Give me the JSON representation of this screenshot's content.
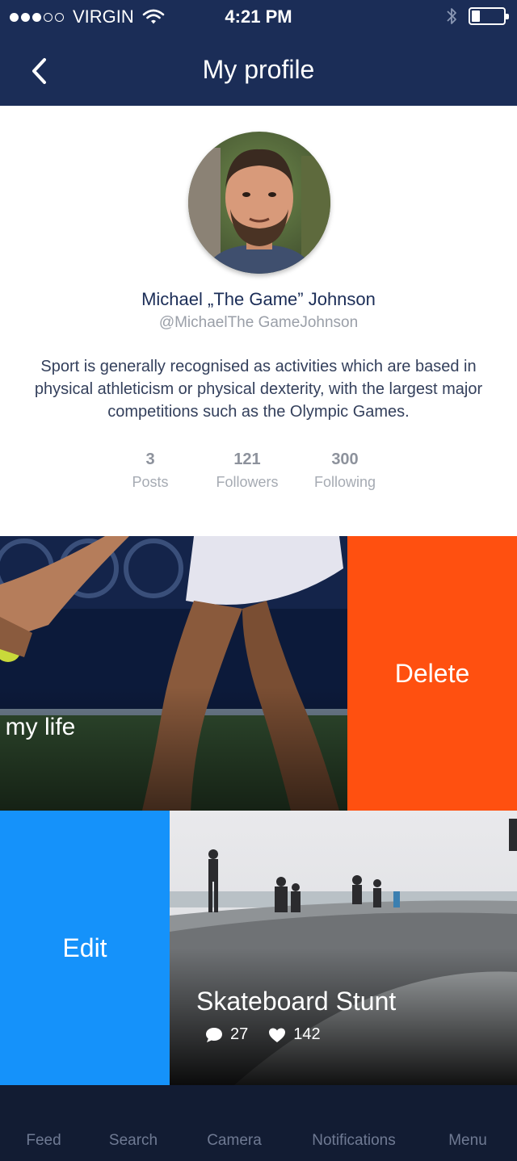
{
  "status_bar": {
    "carrier": "VIRGIN",
    "time": "4:21 PM",
    "signal_bars": 3,
    "signal_total": 5,
    "battery_level": 0.25,
    "icons": [
      "wifi-icon",
      "bluetooth-icon",
      "battery-icon"
    ]
  },
  "nav": {
    "title": "My profile",
    "back_icon": "chevron-left-icon"
  },
  "profile": {
    "name": "Michael „The Game” Johnson",
    "handle": "@MichaelThe GameJohnson",
    "bio": "Sport is generally recognised as activities which are based in physical athleticism or physical dexterity, with the largest major competitions such as the Olympic Games.",
    "stats": [
      {
        "value": "3",
        "label": "Posts"
      },
      {
        "value": "121",
        "label": "Followers"
      },
      {
        "value": "300",
        "label": "Following"
      }
    ]
  },
  "posts": [
    {
      "caption": "f my life",
      "action_label": "Delete",
      "action_color": "#ff5010"
    },
    {
      "title": "Skateboard Stunt",
      "comments": "27",
      "likes": "142",
      "action_label": "Edit",
      "action_color": "#1592fa"
    }
  ],
  "tabbar": {
    "items": [
      {
        "label": "Feed"
      },
      {
        "label": "Search"
      },
      {
        "label": "Camera"
      },
      {
        "label": "Notifications"
      },
      {
        "label": "Menu"
      }
    ]
  },
  "colors": {
    "nav_bg": "#1b2d57",
    "tab_bg": "#121c33",
    "name_text": "#1b2d57",
    "delete": "#ff5010",
    "edit": "#1592fa"
  }
}
